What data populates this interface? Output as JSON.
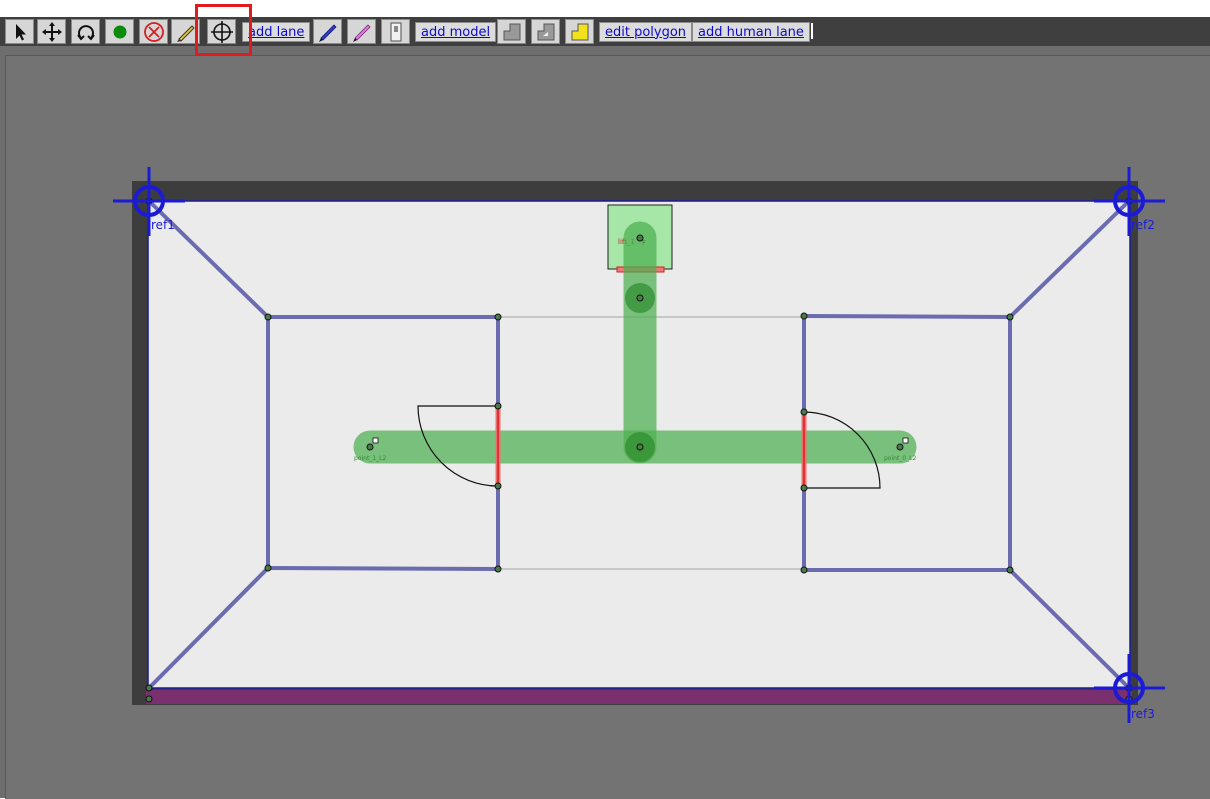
{
  "toolbar": {
    "tools": [
      {
        "name": "select",
        "icon": "pointer-arrow-icon"
      },
      {
        "name": "move",
        "icon": "move-arrows-icon"
      },
      {
        "name": "rotate",
        "icon": "rotate-icon"
      },
      {
        "name": "add-vertex",
        "icon": "green-dot-icon"
      },
      {
        "name": "delete",
        "icon": "delete-circle-icon"
      },
      {
        "name": "add-measurement",
        "icon": "measure-pencil-icon"
      },
      {
        "name": "add-fiducial",
        "icon": "crosshair-icon"
      }
    ],
    "add_lane_label": "add lane",
    "add_wall_icon": "blue-pencil-icon",
    "add_floor_icon": "pink-pencil-icon",
    "add_door_icon": "door-icon",
    "add_model_label": "add model",
    "add_floor_polygon_icon": "floor-polygon-icon",
    "add_hole_icon": "hole-polygon-icon",
    "add_zone_icon": "zone-polygon-icon",
    "edit_polygon_label": "edit polygon",
    "add_human_lane_label": "add human lane"
  },
  "colors": {
    "wall": "#6b6bb0",
    "lane": "#4caf50",
    "door": "#e53935",
    "fiducial": "#1b1bd6",
    "floor": "#ebebeb",
    "lift": "#a6e6a6",
    "floor_edge": "#7a2f6e"
  },
  "map": {
    "fiducials": [
      {
        "label": "ref1"
      },
      {
        "label": "ref2"
      },
      {
        "label": "ref3"
      }
    ],
    "lift_label": "lift_1",
    "lift_marker": "F",
    "lane_point_labels": [
      "point_1_L2",
      "point_0_L2"
    ]
  }
}
